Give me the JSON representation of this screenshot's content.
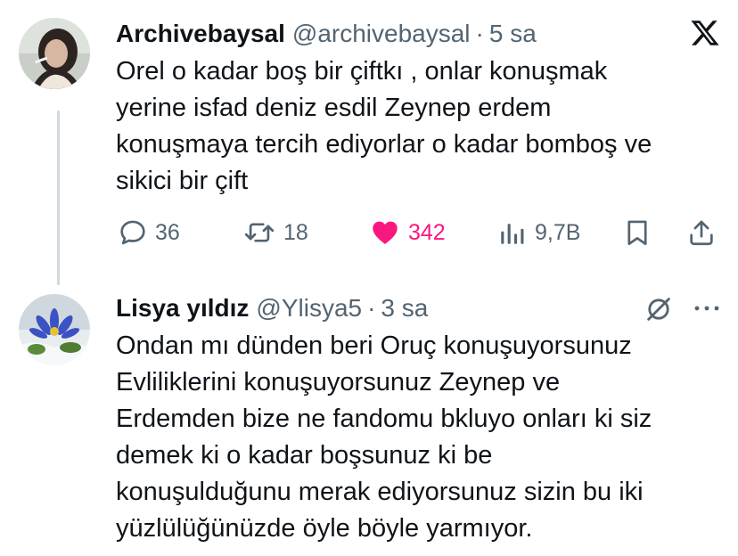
{
  "tweet": {
    "name": "Archivebaysal",
    "handle": "@archivebaysal",
    "separator": "·",
    "time": "5 sa",
    "lines": [
      "Orel o kadar boş bir çiftkı , onlar konuşmak",
      "yerine isfad deniz esdil Zeynep erdem",
      "konuşmaya tercih ediyorlar o kadar bomboş ve",
      "sikici bir çift"
    ],
    "actions": {
      "replies": "36",
      "reposts": "18",
      "likes": "342",
      "views": "9,7B"
    },
    "icons": {
      "platform": "x-logo-icon",
      "reply": "comment-icon",
      "repost": "repost-icon",
      "like": "heart-icon",
      "views": "views-bar-chart-icon",
      "bookmark": "bookmark-icon",
      "share": "share-icon"
    },
    "colors": {
      "like_active": "#f91880",
      "muted": "#536471",
      "text": "#0f1419"
    }
  },
  "reply": {
    "name": "Lisya yıldız",
    "handle": "@Ylisya5",
    "separator": "·",
    "time": "3 sa",
    "lines": [
      "Ondan mı dünden beri Oruç konuşuyorsunuz",
      "Evliliklerini konuşuyorsunuz Zeynep ve",
      "Erdemden bize ne fandomu bkluyo onları ki siz",
      "demek ki o kadar boşsunuz ki be",
      "konuşulduğunu merak ediyorsunuz sizin bu iki",
      "yüzlülüğünüzde öyle böyle yarmıyor."
    ],
    "icons": {
      "grok": "grok-slash-circle-icon",
      "more": "more-options-icon"
    }
  }
}
